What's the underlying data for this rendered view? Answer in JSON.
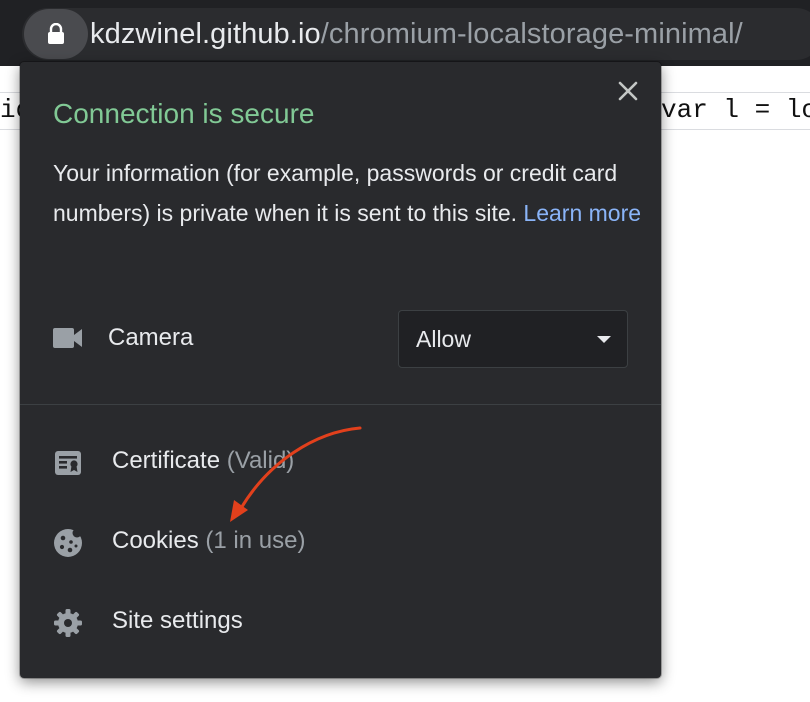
{
  "browser": {
    "url_host": "kdzwinel.github.io",
    "url_path": "/chromium-localstorage-minimal/"
  },
  "page": {
    "code_left": "ioc",
    "code_right": "var l = lo"
  },
  "popup": {
    "title": "Connection is secure",
    "info_text": "Your information (for example, passwords or credit card numbers) is private when it is sent to this site. ",
    "learn_more": "Learn more",
    "permission": {
      "label": "Camera",
      "value": "Allow",
      "icon": "camera-icon"
    },
    "certificate": {
      "label": "Certificate",
      "status": "(Valid)",
      "icon": "certificate-icon"
    },
    "cookies": {
      "label": "Cookies",
      "status": "(1 in use)",
      "icon": "cookie-icon"
    },
    "site_settings": {
      "label": "Site settings",
      "icon": "gear-icon"
    }
  },
  "colors": {
    "title_green": "#81c995",
    "link_blue": "#8ab4f8",
    "popup_bg": "#292a2d",
    "annotation_arrow": "#e2401c"
  }
}
